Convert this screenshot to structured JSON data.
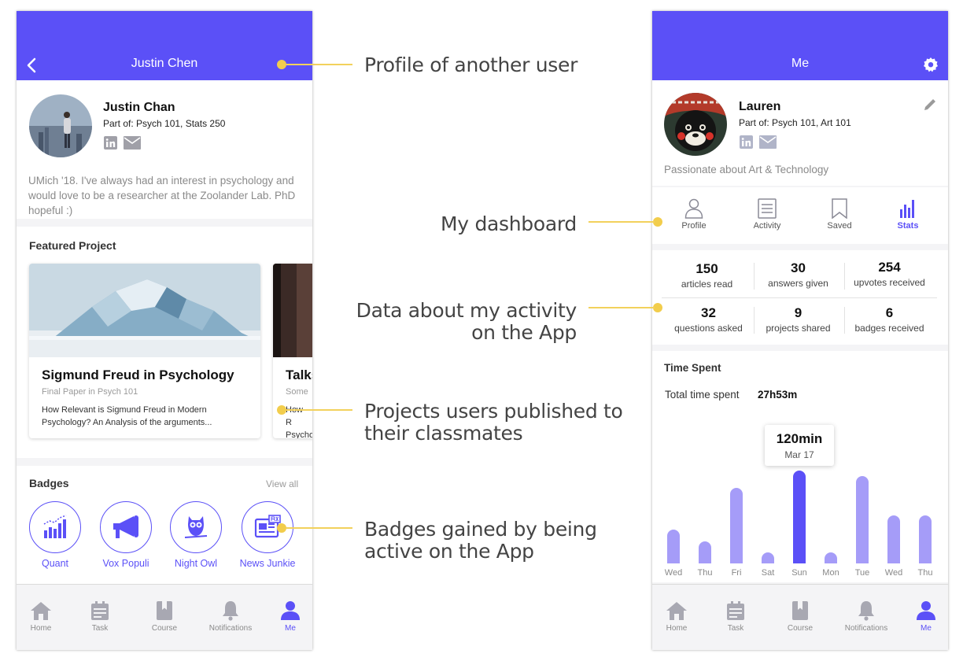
{
  "left_screen": {
    "header": {
      "title": "Justin Chen"
    },
    "profile": {
      "name": "Justin Chan",
      "part_of": "Part of: Psych 101, Stats 250",
      "bio": "UMich '18. I've always had an interest in psychology and would love to be a researcher at the Zoolander Lab. PhD hopeful :)"
    },
    "featured": {
      "title": "Featured Project",
      "cards": [
        {
          "title": "Sigmund Freud in Psychology",
          "subtitle": "Final Paper in Psych 101",
          "description": "How Relevant is Sigmund Freud in Modern Psychology? An Analysis of the arguments..."
        },
        {
          "title": "Talks",
          "subtitle": "Some",
          "description": "How R Psycho"
        }
      ]
    },
    "badges": {
      "title": "Badges",
      "view_all": "View all",
      "items": [
        {
          "label": "Quant",
          "icon": "bar-chart-icon"
        },
        {
          "label": "Vox Populi",
          "icon": "megaphone-icon"
        },
        {
          "label": "Night Owl",
          "icon": "owl-icon"
        },
        {
          "label": "News Junkie",
          "icon": "newspaper-icon"
        }
      ]
    }
  },
  "tabbar": {
    "items": [
      {
        "label": "Home",
        "icon": "home-icon"
      },
      {
        "label": "Task",
        "icon": "calendar-icon"
      },
      {
        "label": "Course",
        "icon": "book-icon"
      },
      {
        "label": "Notifications",
        "icon": "bell-icon"
      },
      {
        "label": "Me",
        "icon": "person-icon",
        "active": true
      }
    ]
  },
  "right_screen": {
    "header": {
      "title": "Me"
    },
    "profile": {
      "name": "Lauren",
      "part_of": "Part of: Psych 101, Art 101",
      "bio": "Passionate about Art & Technology"
    },
    "dashboard_tabs": [
      {
        "label": "Profile",
        "icon": "profile-icon"
      },
      {
        "label": "Activity",
        "icon": "activity-icon"
      },
      {
        "label": "Saved",
        "icon": "bookmark-icon"
      },
      {
        "label": "Stats",
        "icon": "stats-icon",
        "active": true
      }
    ],
    "stats": [
      {
        "value": "150",
        "label": "articles read"
      },
      {
        "value": "30",
        "label": "answers given"
      },
      {
        "value": "254",
        "label": "upvotes received"
      },
      {
        "value": "32",
        "label": "questions asked"
      },
      {
        "value": "9",
        "label": "projects shared"
      },
      {
        "value": "6",
        "label": "badges received"
      }
    ],
    "time_spent": {
      "title": "Time Spent",
      "total_label": "Total time spent",
      "total_value": "27h53m",
      "tooltip": {
        "value": "120min",
        "date": "Mar 17"
      }
    }
  },
  "chart_data": {
    "type": "bar",
    "categories": [
      "Wed",
      "Thu",
      "Fri",
      "Sat",
      "Sun",
      "Mon",
      "Tue",
      "Wed",
      "Thu"
    ],
    "values": [
      37,
      22,
      90,
      8,
      112,
      8,
      105,
      55,
      55
    ],
    "highlight_index": 4,
    "unit": "min",
    "highlight_color": "#5b50f7",
    "bar_color": "#a59cf8"
  },
  "annotations": [
    {
      "text": "Profile of another user"
    },
    {
      "text": "My dashboard"
    },
    {
      "text": "Data about my activity on the App",
      "line1": "Data about my activity",
      "line2": "on the App"
    },
    {
      "text": "Projects users published to their classmates",
      "line1": "Projects users published to",
      "line2": "their classmates"
    },
    {
      "text": "Badges gained by being active on the App",
      "line1": "Badges gained by being",
      "line2": "active on the App"
    }
  ],
  "colors": {
    "accent": "#5b50f7",
    "annotation": "#f2d15c"
  }
}
